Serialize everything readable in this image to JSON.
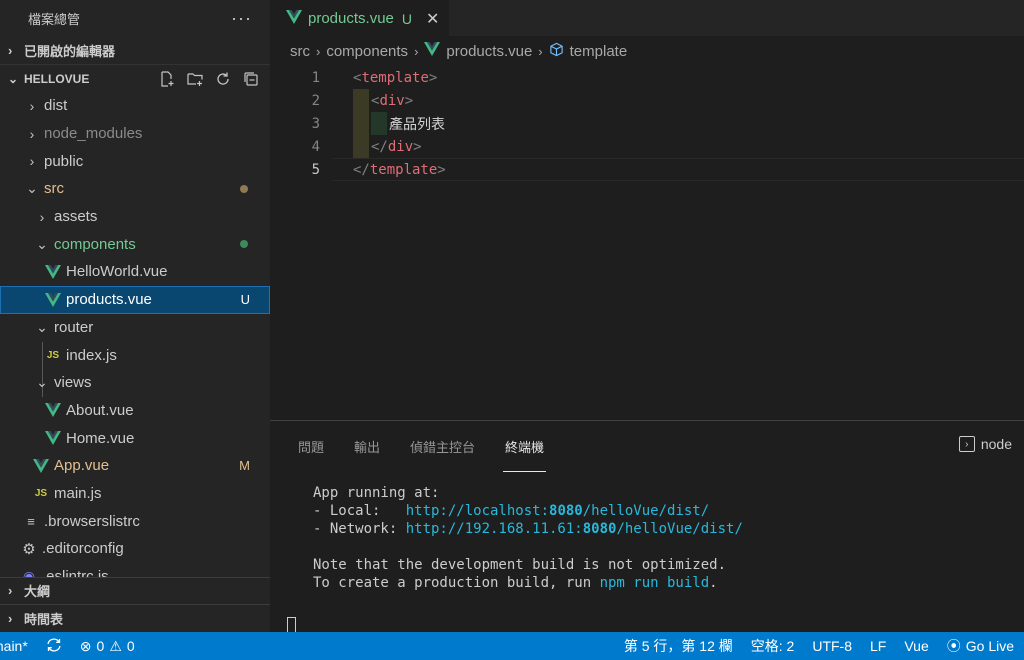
{
  "sidebar": {
    "title": "檔案總管",
    "more": "···",
    "open_editors": "已開啟的編輯器",
    "project": "HELLOVUE",
    "items": [
      {
        "label": "dist",
        "depth": 1,
        "chevron": "right"
      },
      {
        "label": "node_modules",
        "depth": 1,
        "chevron": "right"
      },
      {
        "label": "public",
        "depth": 1,
        "chevron": "right"
      },
      {
        "label": "src",
        "depth": 1,
        "chevron": "down"
      },
      {
        "label": "assets",
        "depth": 2,
        "chevron": "right"
      },
      {
        "label": "components",
        "depth": 2,
        "chevron": "down"
      },
      {
        "label": "HelloWorld.vue",
        "depth": 3
      },
      {
        "label": "products.vue",
        "depth": 3,
        "badge": "U"
      },
      {
        "label": "router",
        "depth": 2,
        "chevron": "down"
      },
      {
        "label": "index.js",
        "depth": 3
      },
      {
        "label": "views",
        "depth": 2,
        "chevron": "down"
      },
      {
        "label": "About.vue",
        "depth": 3
      },
      {
        "label": "Home.vue",
        "depth": 3
      },
      {
        "label": "App.vue",
        "depth": 2,
        "badge": "M"
      },
      {
        "label": "main.js",
        "depth": 2
      },
      {
        "label": ".browserslistrc",
        "depth": 1
      },
      {
        "label": ".editorconfig",
        "depth": 1
      },
      {
        "label": ".eslintrc.js",
        "depth": 1
      }
    ],
    "outline": "大綱",
    "timeline": "時間表"
  },
  "editor": {
    "tab": {
      "name": "products.vue",
      "status": "U",
      "close": "✕"
    },
    "breadcrumb": [
      "src",
      "components",
      "products.vue",
      "template"
    ],
    "lines": [
      {
        "num": "1",
        "open": "<",
        "tag": "template",
        "close": ">"
      },
      {
        "num": "2",
        "open": "<",
        "tag": "div",
        "close": ">"
      },
      {
        "num": "3",
        "text": "產品列表"
      },
      {
        "num": "4",
        "open": "</",
        "tag": "div",
        "close": ">"
      },
      {
        "num": "5",
        "open": "</",
        "tag": "template",
        "close": ">"
      }
    ]
  },
  "panel": {
    "tabs": [
      "問題",
      "輸出",
      "偵錯主控台",
      "終端機"
    ],
    "active_tab": "終端機",
    "terminal_name": "node",
    "output": {
      "running": "App running at:",
      "local_label": "- Local:   ",
      "local_url_a": "http://localhost:",
      "local_port": "8080",
      "local_url_b": "/helloVue/dist/",
      "network_label": "- Network: ",
      "network_url_a": "http://192.168.11.61:",
      "network_port": "8080",
      "network_url_b": "/helloVue/dist/",
      "note1": "Note that the development build is not optimized.",
      "note2_a": "To create a production build, run ",
      "note2_cmd": "npm run build",
      "note2_b": "."
    }
  },
  "status": {
    "branch": "main*",
    "errors": "0",
    "warnings": "0",
    "position": "第 5 行，第 12 欄",
    "spaces": "空格: 2",
    "encoding": "UTF-8",
    "eol": "LF",
    "language": "Vue",
    "golive": "Go Live"
  },
  "colors": {
    "vue_green": "#42b883",
    "git_untracked": "#73c991",
    "git_modified": "#e2c08d",
    "status_bar": "#007acc",
    "selection": "#094771"
  }
}
